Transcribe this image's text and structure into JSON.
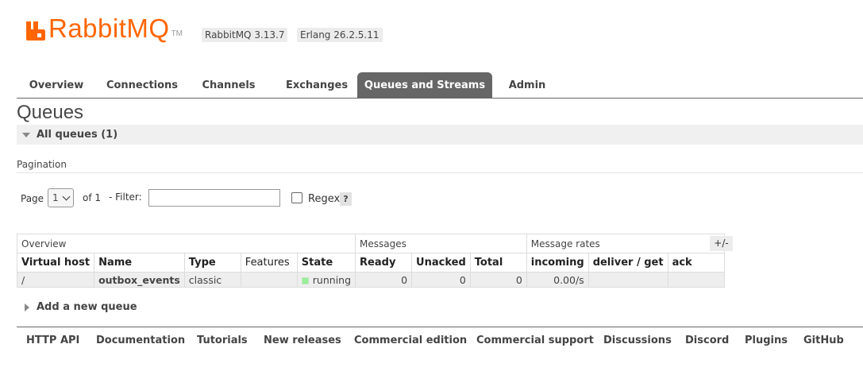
{
  "header": {
    "logo_text": "RabbitMQ",
    "logo_tm": "TM",
    "rabbitmq_version": "RabbitMQ 3.13.7",
    "erlang_version": "Erlang 26.2.5.11",
    "brand_color": "#ff6600"
  },
  "tabs": [
    {
      "label": "Overview"
    },
    {
      "label": "Connections"
    },
    {
      "label": "Channels"
    },
    {
      "label": "Exchanges"
    },
    {
      "label": "Queues and Streams",
      "active": true
    },
    {
      "label": "Admin"
    }
  ],
  "page_title": "Queues",
  "section": {
    "label": "All queues (1)",
    "icon": "triangle-down-icon"
  },
  "pagination": {
    "label": "Pagination",
    "page_label": "Page",
    "page_value": "1",
    "of_label": "of 1",
    "filter_label": "- Filter:",
    "filter_value": "",
    "regex_label": "Regex",
    "help_label": "?"
  },
  "table": {
    "groups": [
      "Overview",
      "Messages",
      "Message rates"
    ],
    "toggle_columns": "+/-",
    "columns": [
      "Virtual host",
      "Name",
      "Type",
      "Features",
      "State",
      "Ready",
      "Unacked",
      "Total",
      "incoming",
      "deliver / get",
      "ack"
    ],
    "rows": [
      {
        "vhost": "/",
        "name": "outbox_events",
        "type": "classic",
        "features": "",
        "state": "running",
        "state_color": "#99ee99",
        "ready": "0",
        "unacked": "0",
        "total": "0",
        "incoming": "0.00/s",
        "deliver_get": "",
        "ack": ""
      }
    ]
  },
  "add_queue": {
    "label": "Add a new queue",
    "icon": "triangle-right-icon"
  },
  "footer": {
    "links": [
      "HTTP API",
      "Documentation",
      "Tutorials",
      "New releases",
      "Commercial edition",
      "Commercial support",
      "Discussions",
      "Discord",
      "Plugins",
      "GitHub"
    ]
  }
}
